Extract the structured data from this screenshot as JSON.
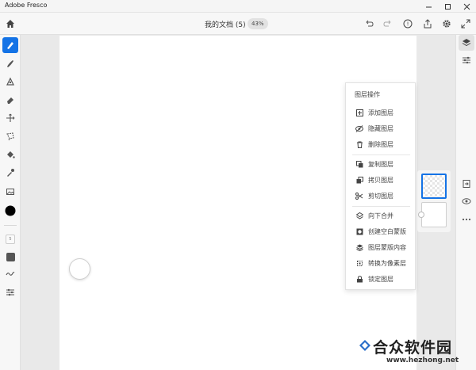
{
  "window": {
    "app_title": "Adobe Fresco",
    "controls": [
      "minimize",
      "maximize",
      "close"
    ]
  },
  "header": {
    "home_icon": "home-icon",
    "document_title": "我的文档 (5)",
    "zoom": "43%",
    "actions": [
      "undo-icon",
      "redo-icon",
      "help-icon",
      "share-icon",
      "settings-icon",
      "fullscreen-icon"
    ]
  },
  "left_toolbar": {
    "tools": [
      "pixel-brush-icon",
      "live-brush-icon",
      "vector-brush-icon",
      "eraser-icon",
      "move-icon",
      "lasso-icon",
      "fill-icon",
      "eyedropper-icon",
      "image-icon"
    ],
    "active_tool": "pixel-brush-icon",
    "color": "#000000",
    "brush_size_label": "5",
    "smoothing_icon": "smoothing-icon",
    "more_icon": "brush-settings-icon"
  },
  "right_toolbar": {
    "tools": [
      "layers-icon",
      "layer-properties-icon"
    ],
    "lower_tools": [
      "import-layer-icon",
      "visibility-icon",
      "more-options-icon"
    ]
  },
  "layer_menu": {
    "title": "图层操作",
    "groups": [
      [
        {
          "label": "添加图层",
          "icon": "add-layer-icon"
        },
        {
          "label": "隐藏图层",
          "icon": "hide-layer-icon"
        },
        {
          "label": "删除图层",
          "icon": "delete-layer-icon"
        }
      ],
      [
        {
          "label": "复制图层",
          "icon": "duplicate-layer-icon"
        },
        {
          "label": "拷贝图层",
          "icon": "copy-layer-icon"
        },
        {
          "label": "剪切图层",
          "icon": "cut-layer-icon"
        }
      ],
      [
        {
          "label": "向下合并",
          "icon": "merge-down-icon"
        },
        {
          "label": "创建空白蒙版",
          "icon": "create-mask-icon"
        },
        {
          "label": "图层蒙版内容",
          "icon": "mask-content-icon"
        },
        {
          "label": "转换为像素层",
          "icon": "convert-pixel-icon"
        },
        {
          "label": "锁定图层",
          "icon": "lock-layer-icon"
        }
      ]
    ]
  },
  "watermark": {
    "brand": "合众软件园",
    "url": "www.hezhong.net"
  },
  "colors": {
    "accent": "#1473e6",
    "canvas": "#ffffff",
    "workspace": "#e9e9e9"
  }
}
